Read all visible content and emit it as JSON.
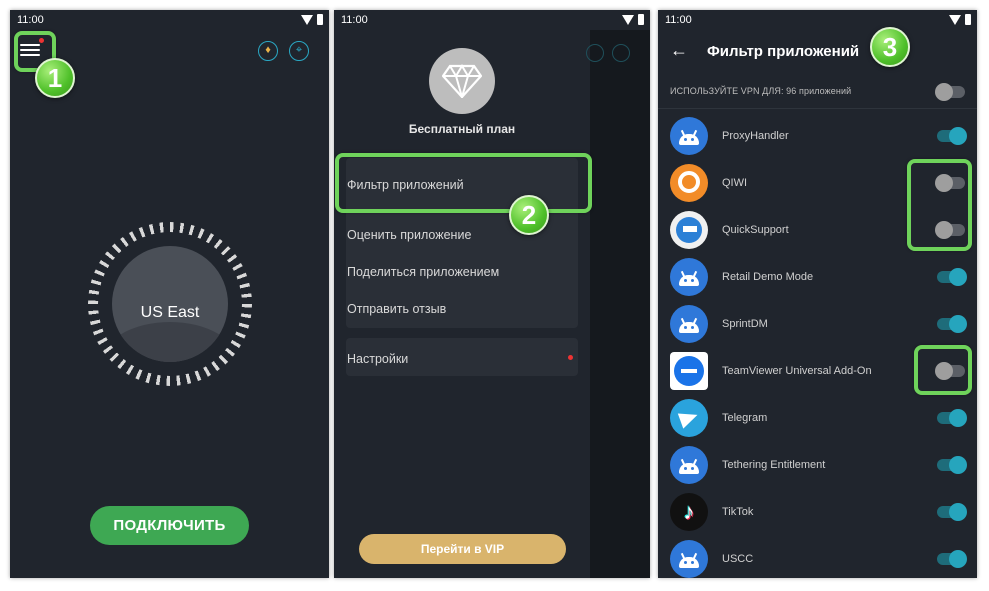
{
  "status_time": "11:00",
  "panel1": {
    "location": "US East",
    "connect_label": "ПОДКЛЮЧИТЬ",
    "step": "1"
  },
  "panel2": {
    "plan_label": "Бесплатный план",
    "menu": {
      "app_filter": "Фильтр приложений",
      "rate_app": "Оценить приложение",
      "share_app": "Поделиться приложением",
      "send_feedback": "Отправить отзыв",
      "settings": "Настройки"
    },
    "vip_label": "Перейти в VIP",
    "step": "2"
  },
  "panel3": {
    "title": "Фильтр приложений",
    "use_vpn_label": "ИСПОЛЬЗУЙТЕ VPN ДЛЯ: 96 приложений",
    "master_toggle": false,
    "step": "3",
    "apps": [
      {
        "name": "ProxyHandler",
        "enabled": true,
        "icon": "android-icon"
      },
      {
        "name": "QIWI",
        "enabled": false,
        "icon": "qiwi-icon"
      },
      {
        "name": "QuickSupport",
        "enabled": false,
        "icon": "quicksupport-icon"
      },
      {
        "name": "Retail Demo Mode",
        "enabled": true,
        "icon": "android-icon"
      },
      {
        "name": "SprintDM",
        "enabled": true,
        "icon": "android-icon"
      },
      {
        "name": "TeamViewer Universal Add-On",
        "enabled": false,
        "icon": "teamviewer-icon"
      },
      {
        "name": "Telegram",
        "enabled": true,
        "icon": "telegram-icon"
      },
      {
        "name": "Tethering Entitlement",
        "enabled": true,
        "icon": "android-icon"
      },
      {
        "name": "TikTok",
        "enabled": true,
        "icon": "tiktok-icon"
      },
      {
        "name": "USCC",
        "enabled": true,
        "icon": "android-icon"
      }
    ]
  },
  "colors": {
    "background": "#20252d",
    "highlight": "#6fd35b",
    "toggle_on": "#26a5bd",
    "connect": "#3ea853",
    "vip": "#d9b46c"
  }
}
